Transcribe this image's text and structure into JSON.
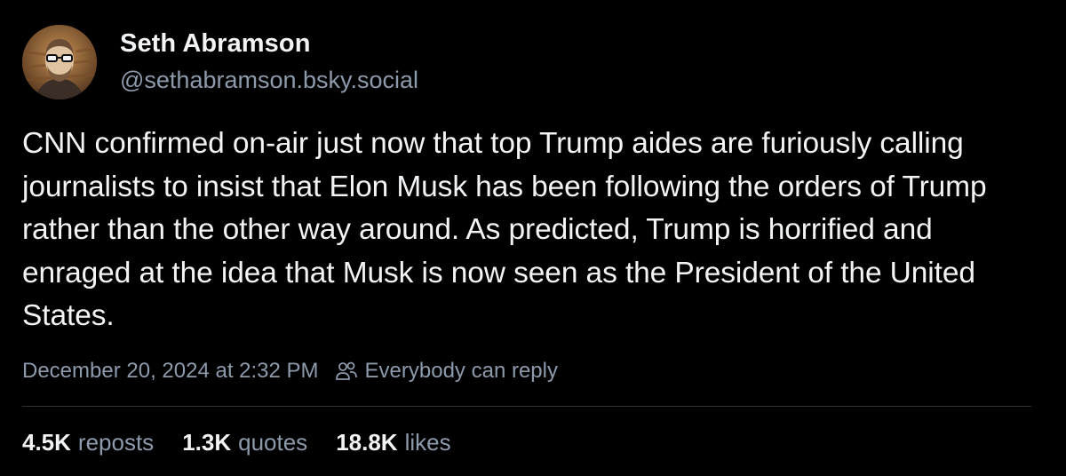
{
  "author": {
    "display_name": "Seth Abramson",
    "handle": "@sethabramson.bsky.social"
  },
  "post": {
    "text": "CNN confirmed on-air just now that top Trump aides are furiously calling journalists to insist that Elon Musk has been following the orders of Trump rather than the other way around. As predicted, Trump is horrified and enraged at the idea that Musk is now seen as the President of the United States.",
    "timestamp": "December 20, 2024 at 2:32 PM",
    "reply_setting": "Everybody can reply",
    "reply_icon": "people-icon"
  },
  "stats": {
    "reposts": {
      "count": "4.5K",
      "label": "reposts"
    },
    "quotes": {
      "count": "1.3K",
      "label": "quotes"
    },
    "likes": {
      "count": "18.8K",
      "label": "likes"
    }
  },
  "colors": {
    "background": "#000000",
    "primary_text": "#f1f3f5",
    "secondary_text": "#8d9aab",
    "divider": "#2e3338"
  }
}
